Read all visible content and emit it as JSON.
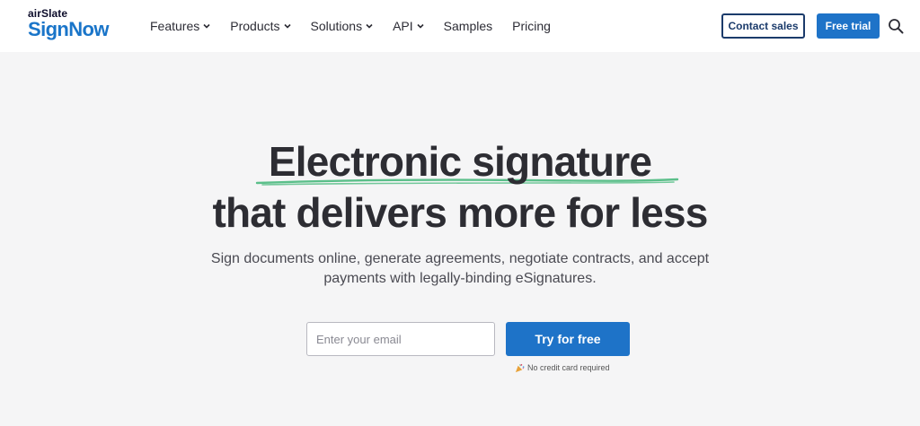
{
  "header": {
    "logo_top": "airSlate",
    "logo_bottom": "SignNow",
    "nav": [
      {
        "label": "Features",
        "has_dropdown": true
      },
      {
        "label": "Products",
        "has_dropdown": true
      },
      {
        "label": "Solutions",
        "has_dropdown": true
      },
      {
        "label": "API",
        "has_dropdown": true
      },
      {
        "label": "Samples",
        "has_dropdown": false
      },
      {
        "label": "Pricing",
        "has_dropdown": false
      }
    ],
    "contact_label": "Contact sales",
    "trial_label": "Free trial",
    "search_icon": "search-icon"
  },
  "hero": {
    "title_line1": "Electronic signature",
    "title_line2": "that delivers more for less",
    "subtitle": "Sign documents online, generate agreements, negotiate contracts, and accept payments with legally-binding eSignatures.",
    "email_placeholder": "Enter your email",
    "email_value": "",
    "cta_label": "Try for free",
    "note": "No credit card required",
    "note_icon": "party-popper-icon"
  },
  "colors": {
    "brand_blue": "#1e73c8",
    "underline_green": "#5bbf8a",
    "dark_navy": "#1b3b6b",
    "background": "#f5f5f6"
  }
}
